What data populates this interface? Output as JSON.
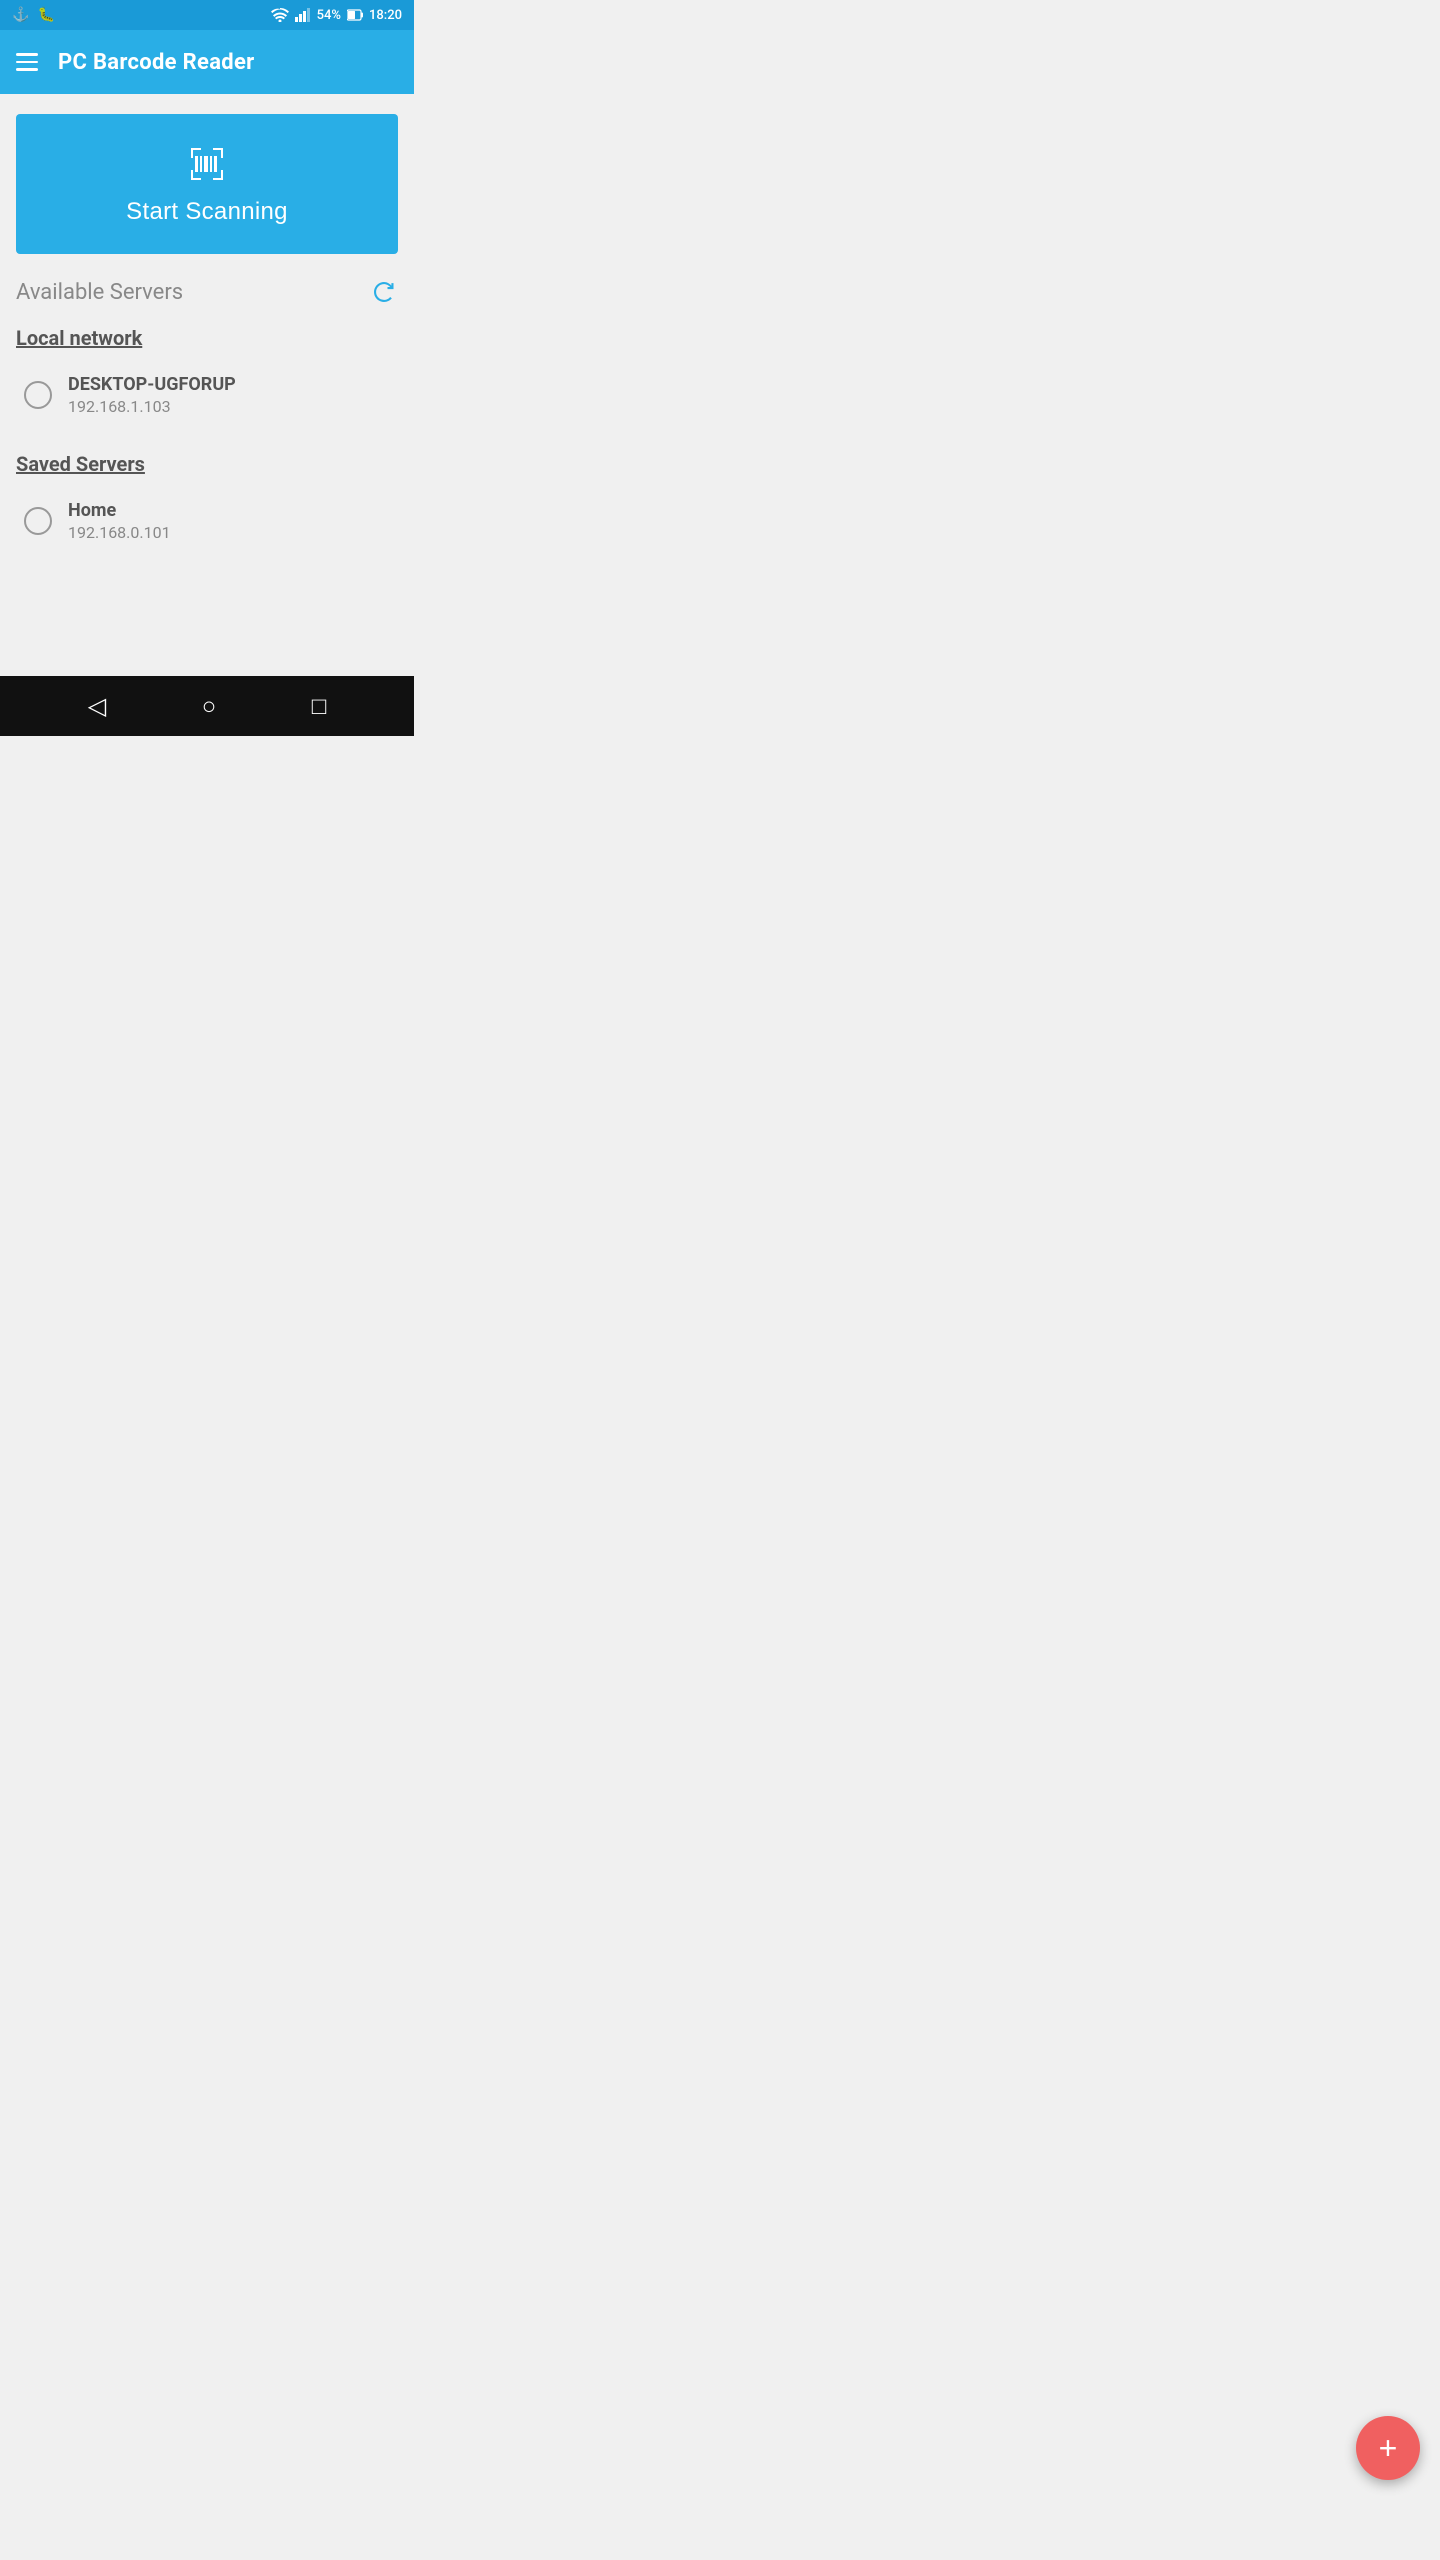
{
  "statusBar": {
    "battery": "54%",
    "time": "18:20",
    "icons": {
      "usb": "⚓",
      "debug": "🐛",
      "wifi": "wifi",
      "signal": "signal"
    }
  },
  "appBar": {
    "title": "PC Barcode Reader",
    "menuIcon": "hamburger"
  },
  "scanButton": {
    "label": "Start Scanning",
    "icon": "barcode-scanner"
  },
  "availableServers": {
    "sectionTitle": "Available Servers",
    "refreshIcon": "refresh",
    "groups": [
      {
        "groupName": "Local network",
        "servers": [
          {
            "name": "DESKTOP-UGFORUP",
            "ip": "192.168.1.103"
          }
        ]
      },
      {
        "groupName": "Saved Servers",
        "servers": [
          {
            "name": "Home",
            "ip": "192.168.0.101"
          }
        ]
      }
    ]
  },
  "fab": {
    "label": "+",
    "icon": "add"
  },
  "navBar": {
    "back": "◁",
    "home": "○",
    "recents": "□"
  },
  "colors": {
    "primary": "#29aee6",
    "statusBar": "#1a9ad7",
    "fab": "#f06060",
    "background": "#f0f0f0"
  }
}
